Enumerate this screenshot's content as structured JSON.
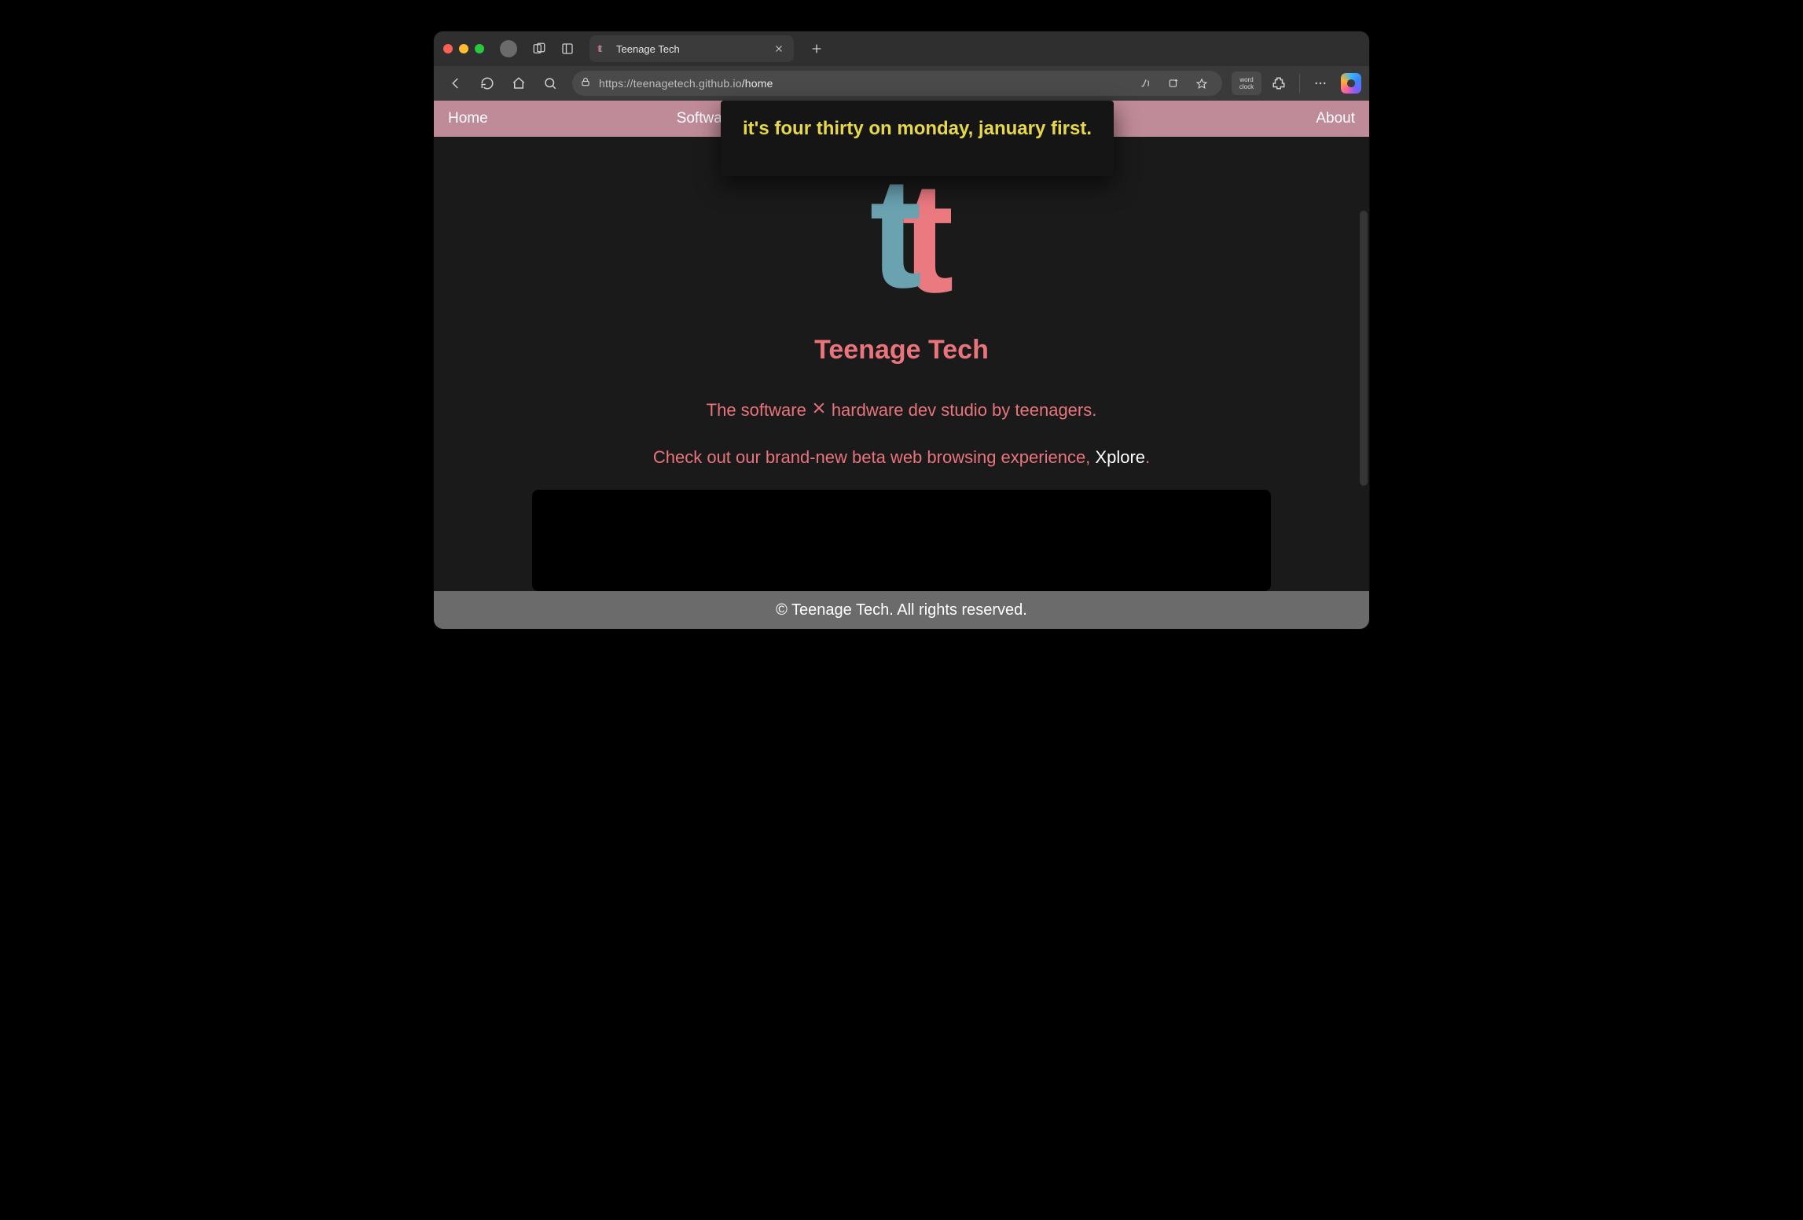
{
  "window": {
    "tab_title": "Teenage Tech",
    "url_scheme_host": "https://teenagetech.github.io",
    "url_path": "/home"
  },
  "toolbar": {
    "wordclock_label": "word\nclock"
  },
  "wordclock": {
    "text": "it's four thirty on monday, january first."
  },
  "nav": {
    "home": "Home",
    "software": "Software",
    "about": "About"
  },
  "page": {
    "brand": "Teenage Tech",
    "tagline_before": "The software",
    "tagline_after": "hardware dev studio by teenagers.",
    "cta_before": "Check out our brand-new beta web browsing experience, ",
    "cta_link": "Xplore",
    "cta_after": ".",
    "footer": "© Teenage Tech. All rights reserved."
  }
}
